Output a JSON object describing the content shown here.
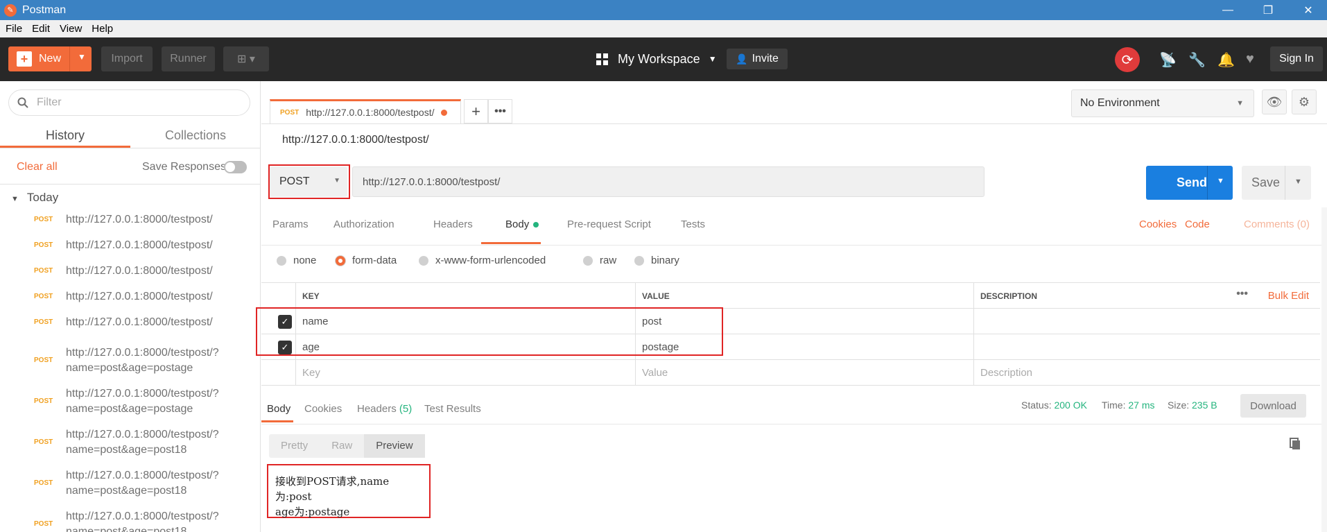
{
  "app": {
    "title": "Postman"
  },
  "menu": [
    "File",
    "Edit",
    "View",
    "Help"
  ],
  "header": {
    "new_label": "New",
    "import_label": "Import",
    "runner_label": "Runner",
    "workspace_label": "My Workspace",
    "invite_label": "Invite",
    "signin_label": "Sign In"
  },
  "sidebar": {
    "filter_placeholder": "Filter",
    "tabs": [
      "History",
      "Collections"
    ],
    "clear_all": "Clear all",
    "save_responses": "Save Responses",
    "group": "Today",
    "items": [
      {
        "method": "POST",
        "url": "http://127.0.0.1:8000/testpost/"
      },
      {
        "method": "POST",
        "url": "http://127.0.0.1:8000/testpost/"
      },
      {
        "method": "POST",
        "url": "http://127.0.0.1:8000/testpost/"
      },
      {
        "method": "POST",
        "url": "http://127.0.0.1:8000/testpost/"
      },
      {
        "method": "POST",
        "url": "http://127.0.0.1:8000/testpost/"
      },
      {
        "method": "POST",
        "url": "http://127.0.0.1:8000/testpost/?name=post&age=postage"
      },
      {
        "method": "POST",
        "url": "http://127.0.0.1:8000/testpost/?name=post&age=postage"
      },
      {
        "method": "POST",
        "url": "http://127.0.0.1:8000/testpost/?name=post&age=post18"
      },
      {
        "method": "POST",
        "url": "http://127.0.0.1:8000/testpost/?name=post&age=post18"
      },
      {
        "method": "POST",
        "url": "http://127.0.0.1:8000/testpost/?name=post&age=post18"
      }
    ]
  },
  "request_tab": {
    "method": "POST",
    "url": "http://127.0.0.1:8000/testpost/"
  },
  "environment": {
    "selected": "No Environment"
  },
  "request": {
    "title": "http://127.0.0.1:8000/testpost/",
    "method": "POST",
    "url": "http://127.0.0.1:8000/testpost/",
    "send_label": "Send",
    "save_label": "Save",
    "tabs": [
      "Params",
      "Authorization",
      "Headers",
      "Body",
      "Pre-request Script",
      "Tests"
    ],
    "right_links": [
      "Cookies",
      "Code",
      "Comments (0)"
    ],
    "body_modes": [
      "none",
      "form-data",
      "x-www-form-urlencoded",
      "raw",
      "binary"
    ],
    "body_mode_selected": "form-data"
  },
  "params_table": {
    "headers": [
      "KEY",
      "VALUE",
      "DESCRIPTION"
    ],
    "bulk_edit": "Bulk Edit",
    "rows": [
      {
        "key": "name",
        "value": "post",
        "description": ""
      },
      {
        "key": "age",
        "value": "postage",
        "description": ""
      }
    ],
    "placeholders": {
      "key": "Key",
      "value": "Value",
      "description": "Description"
    }
  },
  "response": {
    "tabs": [
      "Body",
      "Cookies",
      "Headers",
      "Test Results"
    ],
    "headers_count": "(5)",
    "status_label": "Status:",
    "status_value": "200 OK",
    "time_label": "Time:",
    "time_value": "27 ms",
    "size_label": "Size:",
    "size_value": "235 B",
    "download_label": "Download",
    "view_modes": [
      "Pretty",
      "Raw",
      "Preview"
    ],
    "view_selected": "Preview",
    "body_line1": "接收到POST请求,name为:post",
    "body_line2": "age为:postage"
  },
  "colors": {
    "accent": "#f26b3a",
    "send": "#1a7fe0",
    "titlebar": "#3b82c3",
    "header": "#282828",
    "highlight": "#e02424"
  }
}
